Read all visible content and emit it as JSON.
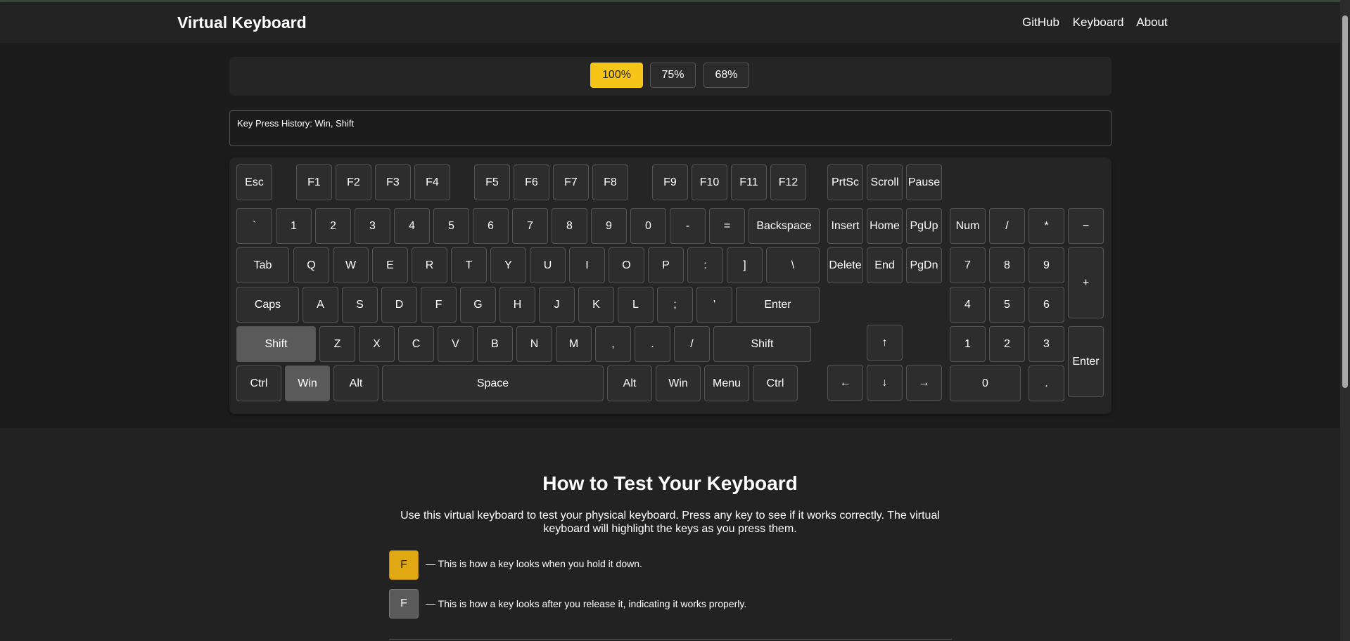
{
  "app": {
    "title": "Virtual Keyboard"
  },
  "nav": {
    "links": [
      "GitHub",
      "Keyboard",
      "About"
    ]
  },
  "size_options": {
    "items": [
      "100%",
      "75%",
      "68%"
    ],
    "selected": "100%"
  },
  "history": {
    "text": "Key Press History: Win, Shift"
  },
  "keyboard": {
    "highlighted_keys": [
      "Win",
      "Shift"
    ],
    "colors": {
      "key_bg": "#2d2d2d",
      "released_bg": "#5a5a5a",
      "held_bg": "#e0a812",
      "accent": "#f5c518"
    },
    "function_row": [
      "Esc",
      "F1",
      "F2",
      "F3",
      "F4",
      "F5",
      "F6",
      "F7",
      "F8",
      "F9",
      "F10",
      "F11",
      "F12",
      "PrtSc",
      "Scroll",
      "Pause"
    ],
    "number_row": [
      "`",
      "1",
      "2",
      "3",
      "4",
      "5",
      "6",
      "7",
      "8",
      "9",
      "0",
      "-",
      "=",
      "Backspace",
      "Insert",
      "Home",
      "PgUp",
      "Num",
      "/",
      "*",
      "−"
    ],
    "tab_row": [
      "Tab",
      "Q",
      "W",
      "E",
      "R",
      "T",
      "Y",
      "U",
      "I",
      "O",
      "P",
      ":",
      "]",
      "\\",
      "Delete",
      "End",
      "PgDn",
      "7",
      "8",
      "9",
      "+"
    ],
    "caps_row": [
      "Caps",
      "A",
      "S",
      "D",
      "F",
      "G",
      "H",
      "J",
      "K",
      "L",
      ";",
      "'",
      "Enter",
      "4",
      "5",
      "6"
    ],
    "shift_row": [
      "Shift",
      "Z",
      "X",
      "C",
      "V",
      "B",
      "N",
      "M",
      ",",
      ".",
      "/",
      "Shift",
      "↑",
      "1",
      "2",
      "3",
      "Enter"
    ],
    "bottom_row": [
      "Ctrl",
      "Win",
      "Alt",
      "Space",
      "Alt",
      "Win",
      "Menu",
      "Ctrl",
      "←",
      "↓",
      "→",
      "0",
      "."
    ]
  },
  "how_to": {
    "title": "How to Test Your Keyboard",
    "description": "Use this virtual keyboard to test your physical keyboard. Press any key to see if it works correctly. The virtual keyboard will highlight the keys as you press them.",
    "held": {
      "key": "F",
      "text": "— This is how a key looks when you hold it down."
    },
    "released": {
      "key": "F",
      "text": "— This is how a key looks after you release it, indicating it works properly."
    }
  }
}
